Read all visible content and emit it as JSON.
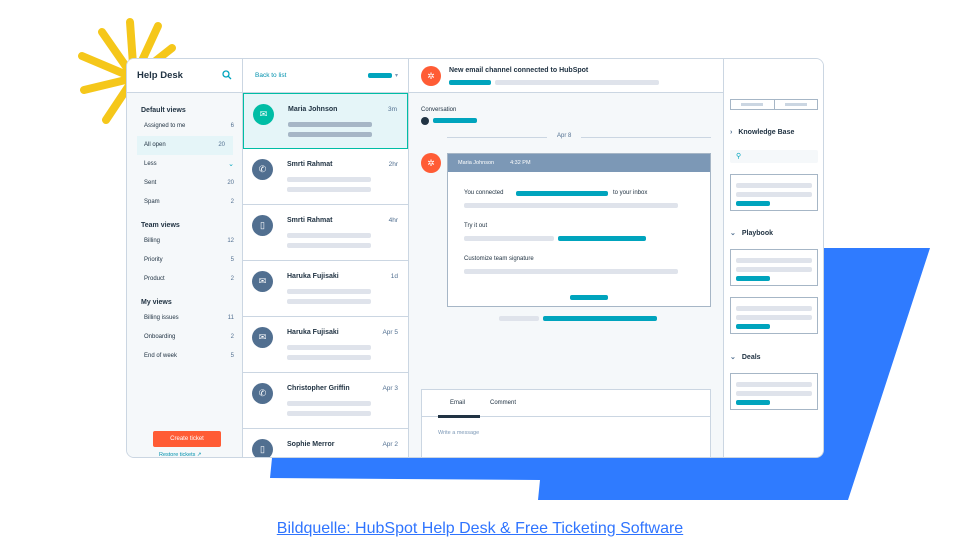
{
  "caption": "Bildquelle: HubSpot Help Desk & Free Ticketing Software",
  "colors": {
    "accent": "#00a4bd",
    "orange": "#ff5c35",
    "blue_shape": "#2f7bff",
    "burst": "#f5c71a"
  },
  "sidebar": {
    "title": "Help Desk",
    "sections": [
      {
        "title": "Default views",
        "items": [
          {
            "label": "Assigned to me",
            "count": "6"
          },
          {
            "label": "All open",
            "count": "20"
          },
          {
            "label": "Less",
            "count": ""
          },
          {
            "label": "Sent",
            "count": "20"
          },
          {
            "label": "Spam",
            "count": "2"
          }
        ]
      },
      {
        "title": "Team views",
        "items": [
          {
            "label": "Billing",
            "count": "12"
          },
          {
            "label": "Priority",
            "count": "5"
          },
          {
            "label": "Product",
            "count": "2"
          }
        ]
      },
      {
        "title": "My views",
        "items": [
          {
            "label": "Billing issues",
            "count": "11"
          },
          {
            "label": "Onboarding",
            "count": "2"
          },
          {
            "label": "End of week",
            "count": "5"
          }
        ]
      }
    ],
    "create_button": "Create ticket",
    "restore_link": "Restore tickets"
  },
  "list": {
    "back_label": "Back to list",
    "tickets": [
      {
        "name": "Maria Johnson",
        "time": "3m",
        "icon": "email-icon"
      },
      {
        "name": "Smrti Rahmat",
        "time": "2hr",
        "icon": "phone-icon"
      },
      {
        "name": "Smrti Rahmat",
        "time": "4hr",
        "icon": "document-icon"
      },
      {
        "name": "Haruka Fujisaki",
        "time": "1d",
        "icon": "email-icon"
      },
      {
        "name": "Haruka Fujisaki",
        "time": "Apr 5",
        "icon": "email-icon"
      },
      {
        "name": "Christopher Griffin",
        "time": "Apr 3",
        "icon": "phone-icon"
      },
      {
        "name": "Sophie Merror",
        "time": "Apr 2",
        "icon": "document-icon"
      }
    ]
  },
  "conversation": {
    "title": "New email channel connected to HubSpot",
    "label": "Conversation",
    "date": "Apr 8",
    "message": {
      "sender": "Maria Johnson",
      "time": "4:32 PM",
      "line1_before": "You connected",
      "line1_after": "to your inbox",
      "line2": "Try it out",
      "line3": "Customize team signature"
    },
    "composer": {
      "tab_email": "Email",
      "tab_comment": "Comment",
      "placeholder": "Write a message"
    }
  },
  "right_panel": {
    "knowledge_base": "Knowledge Base",
    "playbook": "Playbook",
    "deals": "Deals"
  }
}
